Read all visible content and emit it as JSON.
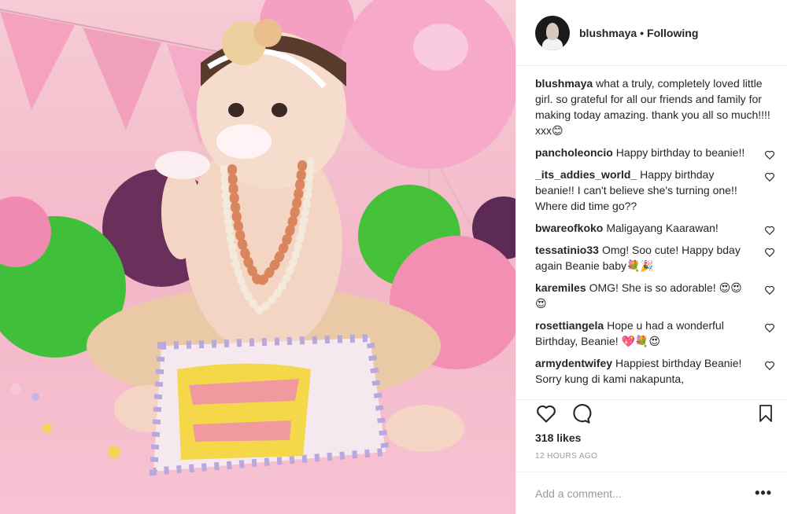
{
  "post": {
    "photo_description_icon": "birthday-photo",
    "author": "blushmaya",
    "follow_status": "Following",
    "separator": "•"
  },
  "comments": [
    {
      "user": "blushmaya",
      "text": "what a truly, completely loved little girl. so grateful for all our friends and family for making today amazing. thank you all so much!!!! xxx😊"
    },
    {
      "user": "pancholeoncio",
      "text": "Happy birthday to beanie!!"
    },
    {
      "user": "_its_addies_world_",
      "text": "Happy birthday beanie!! I can't believe she's turning one!! Where did time go??"
    },
    {
      "user": "bwareofkoko",
      "text": "Maligayang Kaarawan!"
    },
    {
      "user": "tessatinio33",
      "text": "Omg! Soo cute! Happy bday again Beanie baby💐🎉"
    },
    {
      "user": "karemiles",
      "text": "OMG! She is so adorable! 😍😍😍"
    },
    {
      "user": "rosettiangela",
      "text": "Hope u had a wonderful Birthday, Beanie! 💖💐😍"
    },
    {
      "user": "armydentwifey",
      "text": "Happiest birthday Beanie! Sorry kung di kami nakapunta,"
    }
  ],
  "actions": {
    "likes": "318 likes",
    "timestamp": "12 HOURS AGO"
  },
  "add_comment": {
    "placeholder": "Add a comment...",
    "more": "•••"
  },
  "colors": {
    "text": "#262626",
    "muted": "#999999",
    "border": "#efefef",
    "photo_bg": "#f3b7c8"
  }
}
